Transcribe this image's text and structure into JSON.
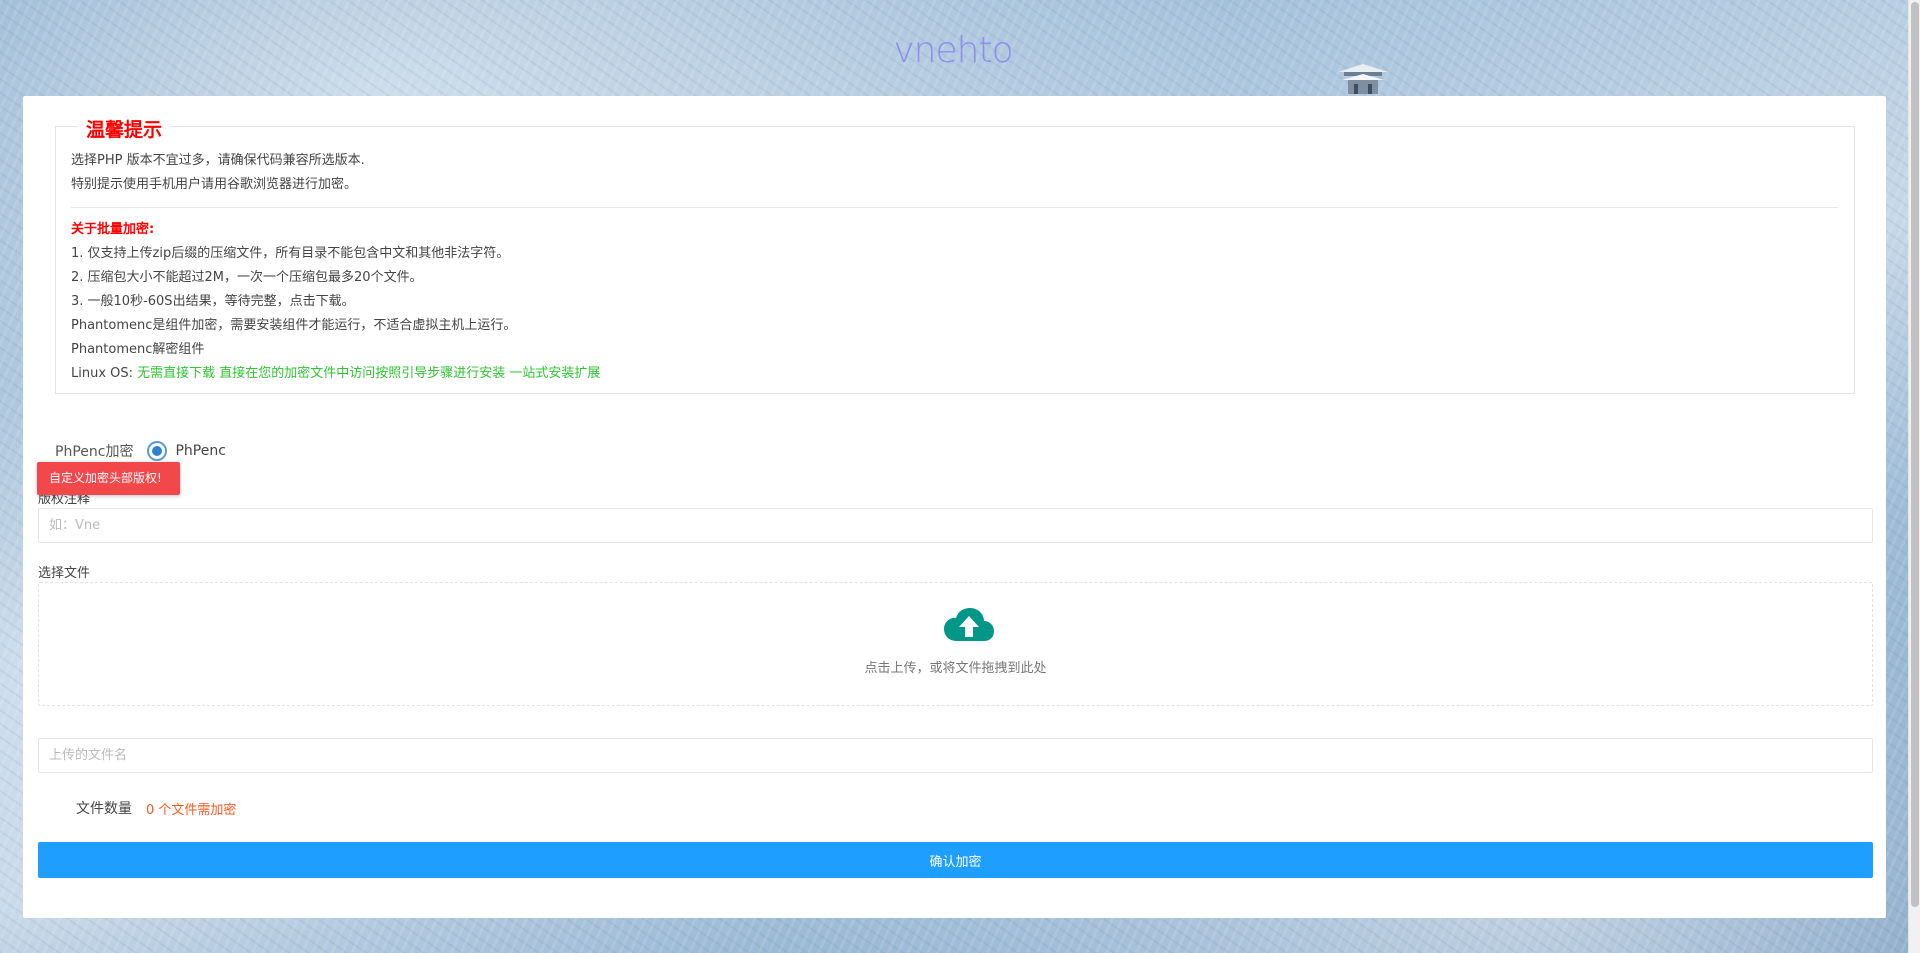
{
  "header": {
    "logo_text": "vnehto"
  },
  "notice": {
    "title": "温馨提示",
    "lines_top": [
      "选择PHP 版本不宜过多，请确保代码兼容所选版本.",
      "特别提示使用手机用户请用谷歌浏览器进行加密。"
    ],
    "batch_title": "关于批量加密:",
    "batch_lines": [
      "1. 仅支持上传zip后缀的压缩文件，所有目录不能包含中文和其他非法字符。",
      "2. 压缩包大小不能超过2M，一次一个压缩包最多20个文件。",
      "3. 一般10秒-60S出结果，等待完整，点击下载。",
      "Phantomenc是组件加密，需要安装组件才能运行，不适合虚拟主机上运行。",
      "Phantomenc解密组件"
    ],
    "linux_label": "Linux OS: ",
    "linux_link": "无需直接下载 直接在您的加密文件中访问按照引导步骤进行安装 一站式安装扩展"
  },
  "form": {
    "mode_label": "PhPenc加密",
    "mode_option": "PhPenc",
    "tooltip": "自定义加密头部版权!",
    "copyright_label": "版权注释",
    "copyright_placeholder": "如：Vne",
    "file_label": "选择文件",
    "upload_hint": "点击上传，或将文件拖拽到此处",
    "filename_placeholder": "上传的文件名",
    "count_label": "文件数量",
    "count_value": "0 个文件需加密",
    "submit_label": "确认加密"
  },
  "colors": {
    "accent": "#1e9fff",
    "warning_red": "#ff0000",
    "link_green": "#2fc531",
    "count_orange": "#ff5722",
    "upload_icon": "#009688",
    "tooltip_bg": "#f2484b"
  }
}
